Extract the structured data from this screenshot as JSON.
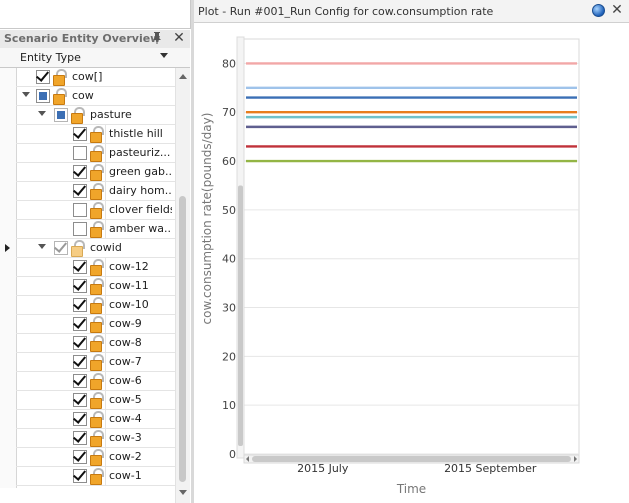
{
  "scenario_panel": {
    "title": "Scenario Entity Overview",
    "pin_icon": "pin-icon",
    "close_icon": "close-icon",
    "column_header": "Entity Type",
    "rows": [
      {
        "label": "cow[]",
        "level": 0,
        "expand": false,
        "state": "checked",
        "lock": "lock-icon"
      },
      {
        "label": "cow",
        "level": 0,
        "expand": true,
        "state": "indeterminate",
        "lock": "lock-icon"
      },
      {
        "label": "pasture",
        "level": 1,
        "expand": true,
        "state": "indeterminate-grey",
        "lock": "lock-icon"
      },
      {
        "label": "thistle hill",
        "level": 2,
        "expand": false,
        "state": "checked",
        "lock": "lock-icon"
      },
      {
        "label": "pasteuriz...",
        "level": 2,
        "expand": false,
        "state": "unchecked",
        "lock": "lock-icon"
      },
      {
        "label": "green gab...",
        "level": 2,
        "expand": false,
        "state": "checked",
        "lock": "lock-icon"
      },
      {
        "label": "dairy hom...",
        "level": 2,
        "expand": false,
        "state": "checked",
        "lock": "lock-icon"
      },
      {
        "label": "clover fields",
        "level": 2,
        "expand": false,
        "state": "unchecked",
        "lock": "lock-icon"
      },
      {
        "label": "amber wa...",
        "level": 2,
        "expand": false,
        "state": "unchecked",
        "lock": "lock-icon"
      },
      {
        "label": "cowid",
        "level": 1,
        "expand": true,
        "state": "checked-grey",
        "lock": "lock-icon",
        "current": true
      },
      {
        "label": "cow-12",
        "level": 2,
        "expand": false,
        "state": "checked",
        "lock": "lock-icon"
      },
      {
        "label": "cow-11",
        "level": 2,
        "expand": false,
        "state": "checked",
        "lock": "lock-icon"
      },
      {
        "label": "cow-10",
        "level": 2,
        "expand": false,
        "state": "checked",
        "lock": "lock-icon"
      },
      {
        "label": "cow-9",
        "level": 2,
        "expand": false,
        "state": "checked",
        "lock": "lock-icon"
      },
      {
        "label": "cow-8",
        "level": 2,
        "expand": false,
        "state": "checked",
        "lock": "lock-icon"
      },
      {
        "label": "cow-7",
        "level": 2,
        "expand": false,
        "state": "checked",
        "lock": "lock-icon"
      },
      {
        "label": "cow-6",
        "level": 2,
        "expand": false,
        "state": "checked",
        "lock": "lock-icon"
      },
      {
        "label": "cow-5",
        "level": 2,
        "expand": false,
        "state": "checked",
        "lock": "lock-icon"
      },
      {
        "label": "cow-4",
        "level": 2,
        "expand": false,
        "state": "checked",
        "lock": "lock-icon"
      },
      {
        "label": "cow-3",
        "level": 2,
        "expand": false,
        "state": "checked",
        "lock": "lock-icon"
      },
      {
        "label": "cow-2",
        "level": 2,
        "expand": false,
        "state": "checked",
        "lock": "lock-icon"
      },
      {
        "label": "cow-1",
        "level": 2,
        "expand": false,
        "state": "checked",
        "lock": "lock-icon"
      }
    ]
  },
  "plot_panel": {
    "title": "Plot - Run #001_Run Config for cow.consumption rate",
    "globe_icon": "globe-icon",
    "close_icon": "close-icon"
  },
  "chart_data": {
    "type": "line",
    "xlabel": "Time",
    "ylabel": "cow.consumption rate(pounds/day)",
    "ylim": [
      0,
      85
    ],
    "yticks": [
      0,
      10,
      20,
      30,
      40,
      50,
      60,
      70,
      80
    ],
    "x_ticks": [
      "2015 July",
      "2015 September"
    ],
    "grid": true,
    "series": [
      {
        "y": 80,
        "color": "#f2a7a7"
      },
      {
        "y": 75,
        "color": "#9fc3ea"
      },
      {
        "y": 73,
        "color": "#3a6fb5"
      },
      {
        "y": 70,
        "color": "#e87d1e"
      },
      {
        "y": 69,
        "color": "#6fc1c9"
      },
      {
        "y": 67,
        "color": "#5f5f8f"
      },
      {
        "y": 63,
        "color": "#c0323a"
      },
      {
        "y": 60,
        "color": "#93b545"
      }
    ]
  }
}
